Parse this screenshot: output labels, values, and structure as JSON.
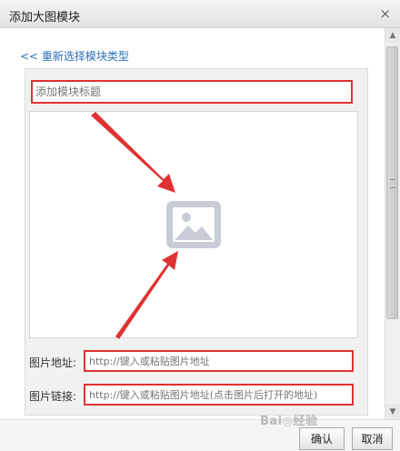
{
  "dialog": {
    "title": "添加大图模块",
    "close_symbol": "×"
  },
  "back_link": "<< 重新选择模块类型",
  "title_input": {
    "placeholder": "添加模块标题"
  },
  "image_url": {
    "label": "图片地址:",
    "placeholder": "http://键入或粘贴图片地址"
  },
  "image_link": {
    "label": "图片链接:",
    "placeholder": "http://键入或粘贴图片地址(点击图片后打开的地址)"
  },
  "buttons": {
    "confirm": "确认",
    "cancel": "取消"
  },
  "watermark": "Bai◎经验",
  "colors": {
    "highlight": "#e03232",
    "link": "#2a6fb6",
    "icon": "#c7ccd6"
  }
}
